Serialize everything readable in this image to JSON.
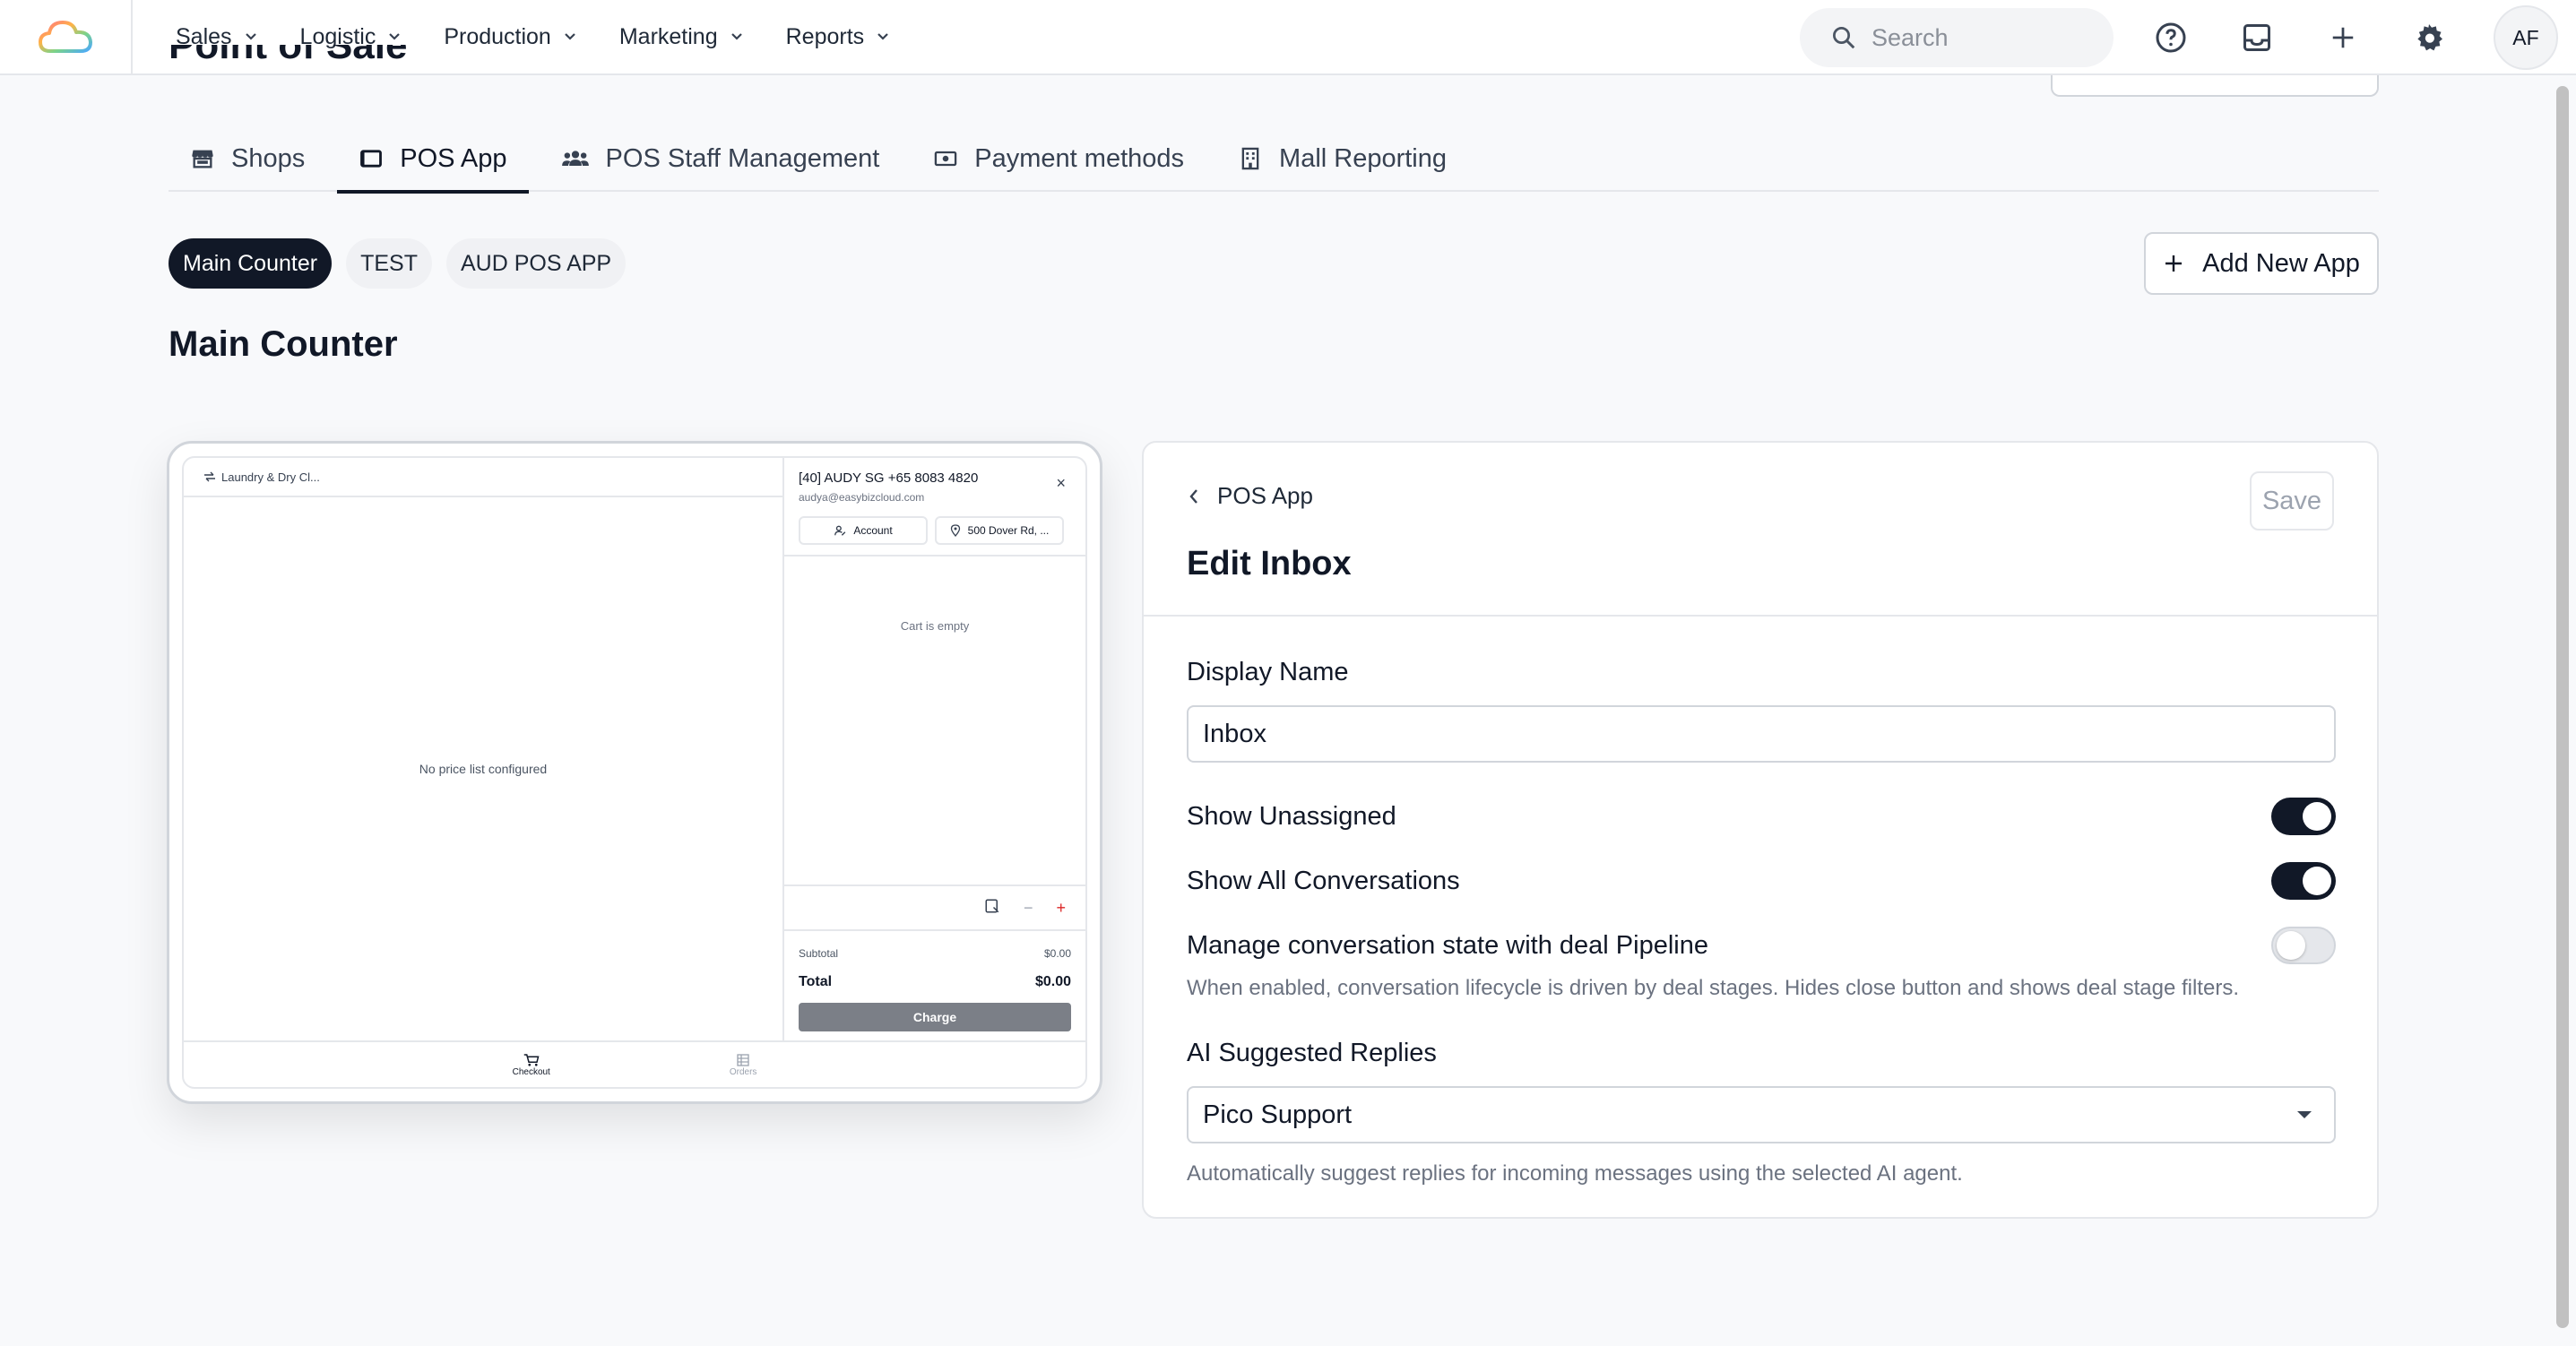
{
  "nav": {
    "items": [
      {
        "label": "Sales"
      },
      {
        "label": "Logistic"
      },
      {
        "label": "Production"
      },
      {
        "label": "Marketing"
      },
      {
        "label": "Reports"
      }
    ],
    "search_placeholder": "Search",
    "avatar_initials": "AF"
  },
  "page": {
    "title": "Point of Sale"
  },
  "tabs": [
    {
      "label": "Shops",
      "icon": "store-icon"
    },
    {
      "label": "POS App",
      "icon": "tablet-icon",
      "active": true
    },
    {
      "label": "POS Staff Management",
      "icon": "users-icon"
    },
    {
      "label": "Payment methods",
      "icon": "payment-icon"
    },
    {
      "label": "Mall Reporting",
      "icon": "building-icon"
    }
  ],
  "apps": {
    "pills": [
      "Main Counter",
      "TEST",
      "AUD POS APP"
    ],
    "selected": "Main Counter",
    "add_label": "Add New App"
  },
  "section_title": "Main Counter",
  "preview": {
    "shop_name": "Laundry & Dry Cl...",
    "empty_price_list": "No price list configured",
    "customer_name": "[40] AUDY SG +65 8083 4820",
    "customer_email": "audya@easybizcloud.com",
    "account_label": "Account",
    "address_label": "500 Dover Rd, ...",
    "cart_empty": "Cart is empty",
    "subtotal_label": "Subtotal",
    "subtotal_value": "$0.00",
    "total_label": "Total",
    "total_value": "$0.00",
    "charge_label": "Charge",
    "nav_checkout": "Checkout",
    "nav_orders": "Orders"
  },
  "edit_inbox": {
    "back_label": "POS App",
    "title": "Edit Inbox",
    "save_label": "Save",
    "display_name_label": "Display Name",
    "display_name_value": "Inbox",
    "show_unassigned_label": "Show Unassigned",
    "show_unassigned": true,
    "show_all_label": "Show All Conversations",
    "show_all": true,
    "pipeline_label": "Manage conversation state with deal Pipeline",
    "pipeline": false,
    "pipeline_help": "When enabled, conversation lifecycle is driven by deal stages. Hides close button and shows deal stage filters.",
    "ai_label": "AI Suggested Replies",
    "ai_value": "Pico Support",
    "ai_help": "Automatically suggest replies for incoming messages using the selected AI agent."
  },
  "colors": {
    "accent": "#111827",
    "background": "#f8f9fb",
    "border": "#e5e7eb"
  }
}
